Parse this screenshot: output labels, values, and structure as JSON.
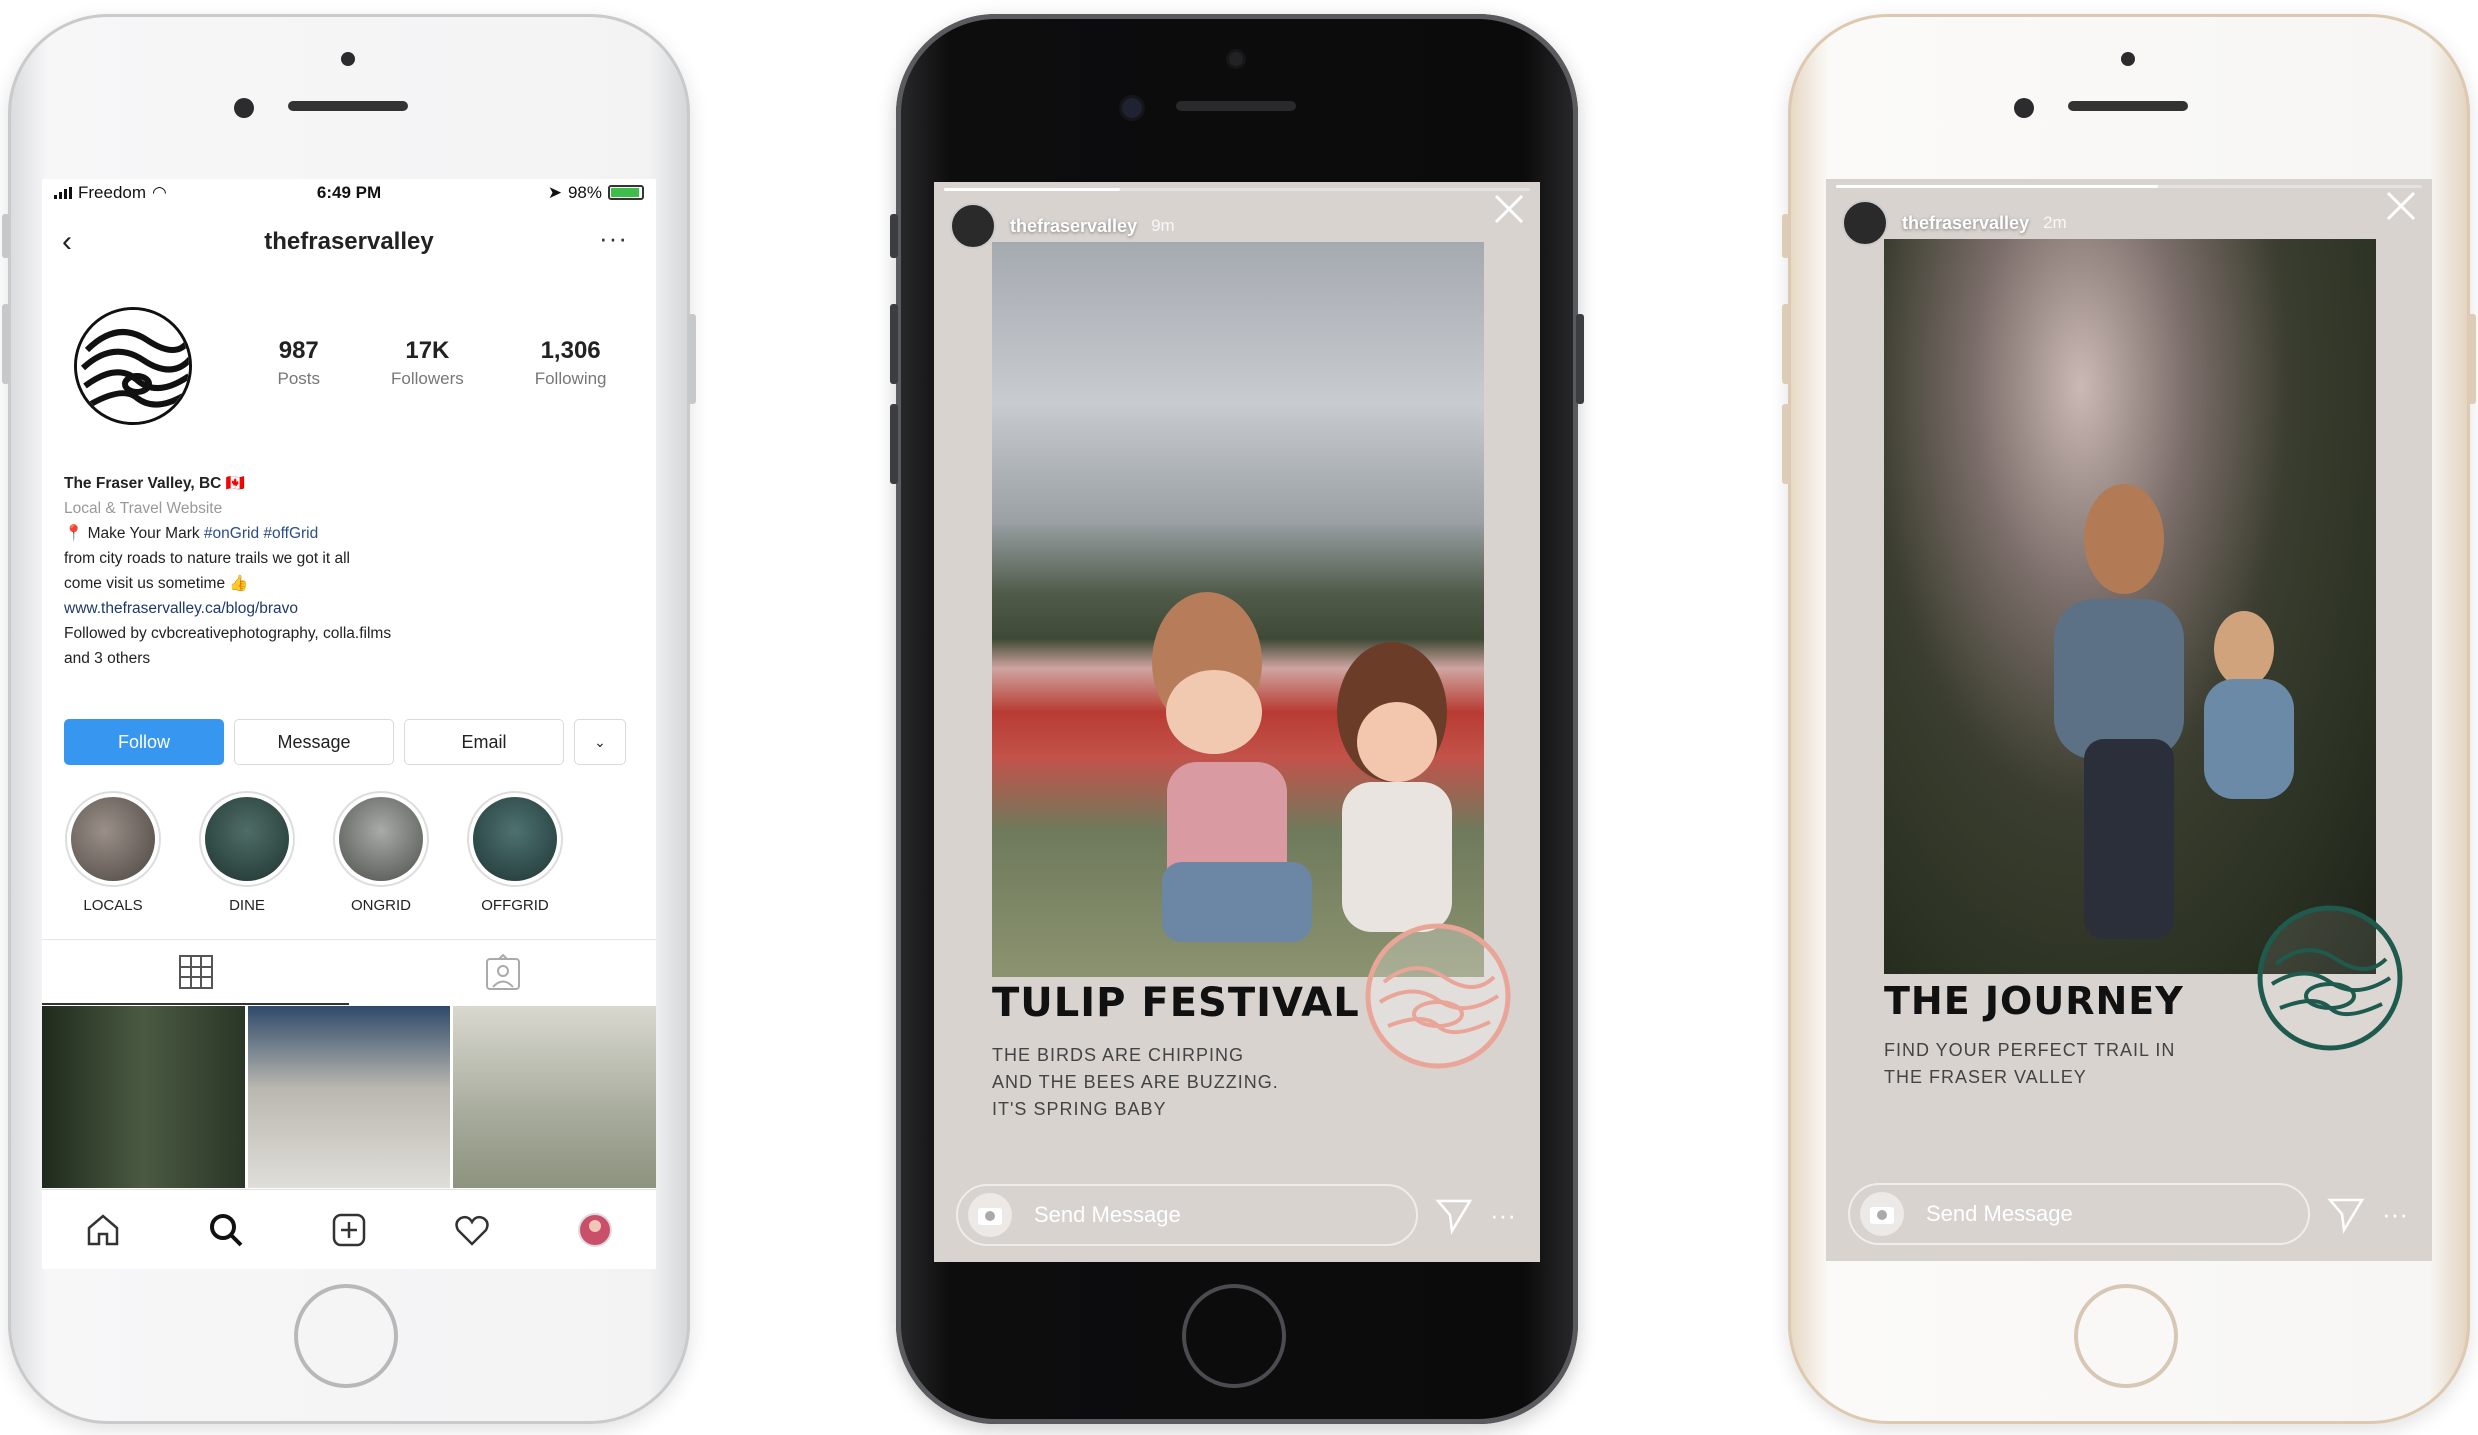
{
  "profile": {
    "status": {
      "carrier": "Freedom",
      "time": "6:49 PM",
      "battery": "98%"
    },
    "username": "thefraservalley",
    "stats": [
      {
        "value": "987",
        "label": "Posts"
      },
      {
        "value": "17K",
        "label": "Followers"
      },
      {
        "value": "1,306",
        "label": "Following"
      }
    ],
    "bio": {
      "name": "The Fraser Valley, BC 🇨🇦",
      "category": "Local & Travel Website",
      "line1": "📍 Make Your Mark",
      "tags": "#onGrid #offGrid",
      "line2": "from city roads to nature trails we got it all",
      "line3": "come visit us sometime 👍",
      "link": "www.thefraservalley.ca/blog/bravo",
      "followed1": "Followed by cvbcreativephotography, colla.films",
      "followed2": "and 3 others"
    },
    "buttons": {
      "follow": "Follow",
      "message": "Message",
      "email": "Email",
      "dropdown": "⌄"
    },
    "highlights": [
      {
        "label": "LOCALS",
        "color": "#6d6560"
      },
      {
        "label": "DINE",
        "color": "#2c4742"
      },
      {
        "label": "ONGRID",
        "color": "#6a6e6a"
      },
      {
        "label": "OFFGRID",
        "color": "#2e4c4b"
      }
    ],
    "tiles": [
      "#2f3a2d",
      "#b5b3ac",
      "#c8c6bb"
    ]
  },
  "story1": {
    "username": "thefraservalley",
    "time": "9m",
    "title": "TULIP FESTIVAL",
    "subtitle": [
      "THE BIRDS ARE CHIRPING",
      "AND THE BEES ARE BUZZING.",
      "IT'S SPRING BABY"
    ],
    "send_label": "Send Message",
    "badge_color": "#e9a597"
  },
  "story2": {
    "username": "thefraservalley",
    "time": "2m",
    "title": "THE JOURNEY",
    "subtitle": [
      "FIND YOUR PERFECT TRAIL IN",
      "THE FRASER VALLEY"
    ],
    "send_label": "Send Message",
    "badge_color": "#1f5a4f"
  }
}
